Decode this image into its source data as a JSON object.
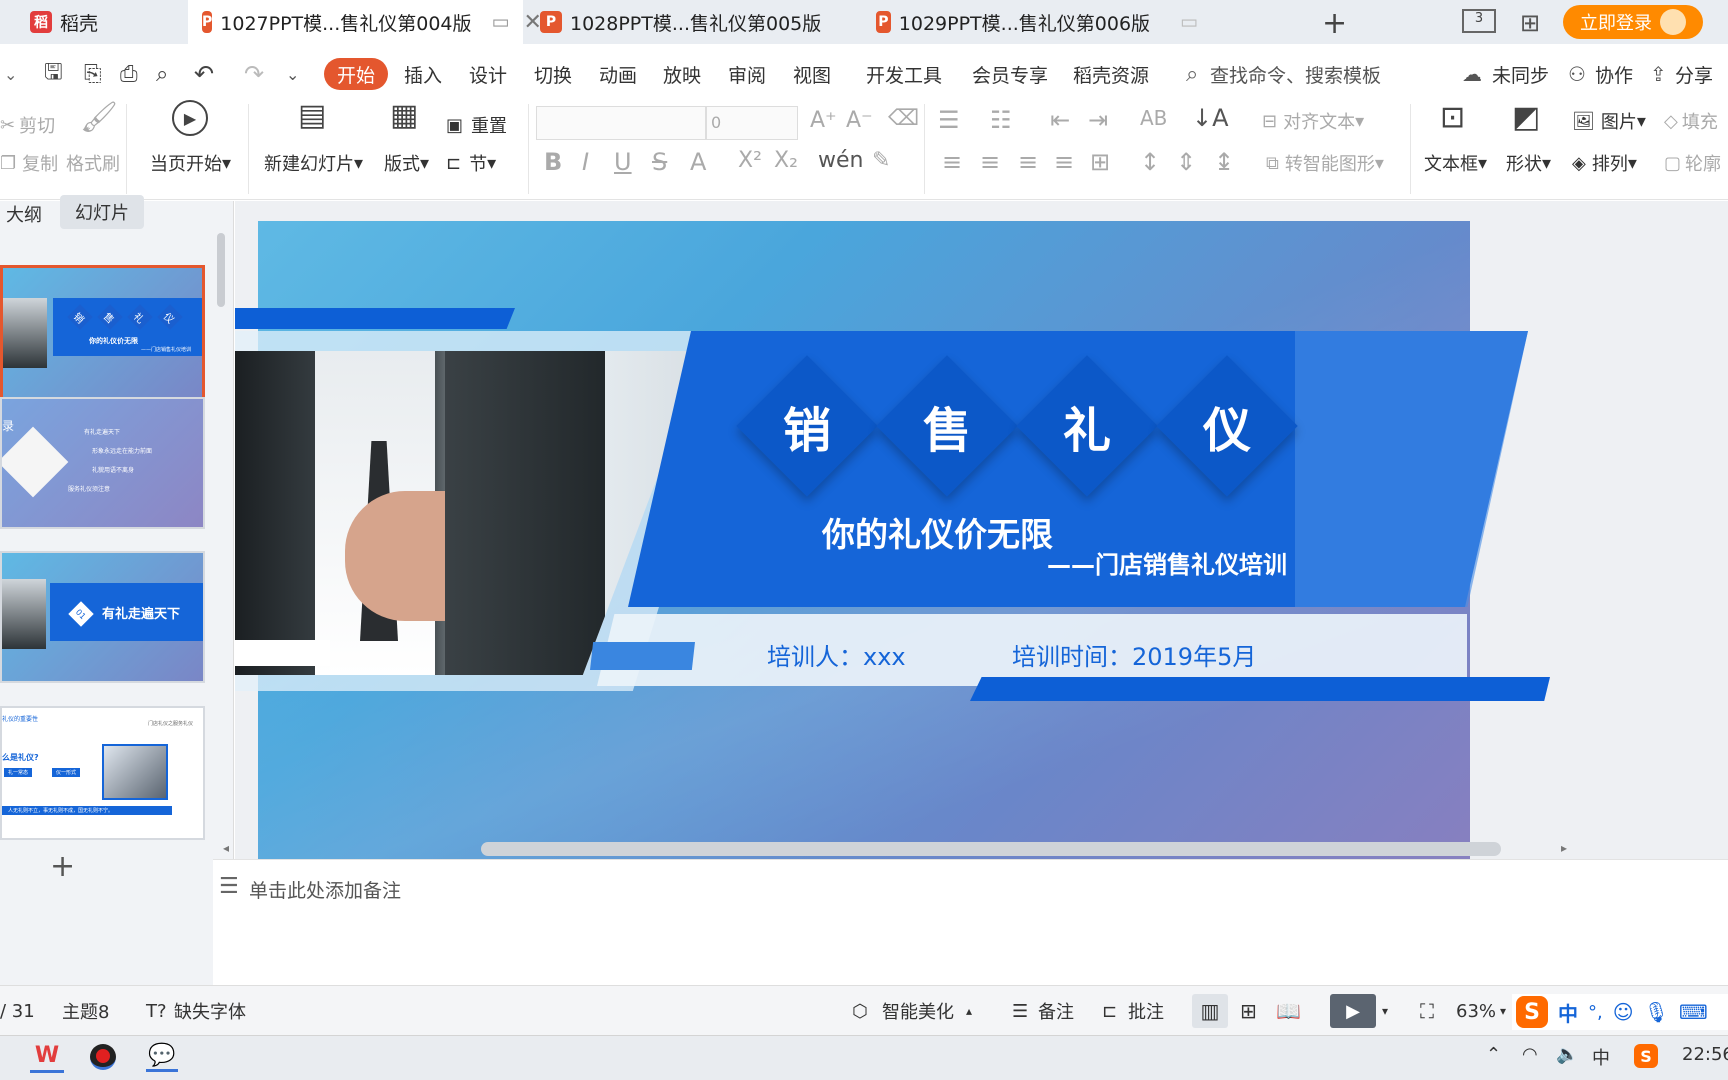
{
  "tabs": [
    {
      "label": "稻壳",
      "icon": "docer-icon"
    },
    {
      "label": "1027PPT模...售礼仪第004版",
      "icon": "ppt-icon"
    },
    {
      "label": "1028PPT模...售礼仪第005版",
      "icon": "ppt-icon"
    },
    {
      "label": "1029PPT模...售礼仪第006版",
      "icon": "ppt-icon"
    }
  ],
  "login_label": "立即登录",
  "menu": [
    "开始",
    "插入",
    "设计",
    "切换",
    "动画",
    "放映",
    "审阅",
    "视图",
    "开发工具",
    "会员专享",
    "稻壳资源"
  ],
  "search_placeholder": "查找命令、搜索模板",
  "right_menu": {
    "sync": "未同步",
    "collab": "协作",
    "share": "分享"
  },
  "ribbon": {
    "cut": "剪切",
    "copy": "复制",
    "format_painter": "格式刷",
    "start_from_current": "当页开始",
    "new_slide": "新建幻灯片",
    "layout": "版式",
    "reset": "重置",
    "section": "节",
    "font_size": "0",
    "align_text": "对齐文本",
    "smart_shape": "转智能图形",
    "textbox": "文本框",
    "shape": "形状",
    "picture": "图片",
    "arrange": "排列",
    "fill": "填充",
    "outline": "轮廓"
  },
  "left_tabs": {
    "outline": "大纲",
    "slides": "幻灯片"
  },
  "thumbs": [
    {
      "title_chars": [
        "销",
        "售",
        "礼",
        "仪"
      ],
      "subtitle": "你的礼仪价无限",
      "sub2": "——门店销售礼仪培训"
    },
    {
      "heading": "录",
      "items": [
        "有礼走遍天下",
        "形象永远走在能力前面",
        "礼貌用语不离身",
        "服务礼仪须注意"
      ]
    },
    {
      "num": "01",
      "title": "有礼走遍天下"
    },
    {
      "tag_left": "礼仪的重要性",
      "tag_right": "门店礼仪之服务礼仪",
      "question": "么是礼仪?",
      "chip1": "礼一常态",
      "chip2": "仪一形式",
      "footer": "人无礼则不立，事无礼则不成，国无礼则不宁。"
    }
  ],
  "slide": {
    "title_chars": [
      "销",
      "售",
      "礼",
      "仪"
    ],
    "subtitle": "你的礼仪价无限",
    "sub2": "——门店销售礼仪培训",
    "trainer": "培训人：xxx",
    "time": "培训时间：2019年5月"
  },
  "notes_placeholder": "单击此处添加备注",
  "status": {
    "page": "/ 31",
    "theme": "主题8",
    "missing_font": "缺失字体",
    "beautify": "智能美化",
    "notes": "备注",
    "comment": "批注",
    "zoom": "63%"
  },
  "ime": {
    "lang": "中",
    "punct": "°,"
  },
  "taskbar": {
    "ime": "中",
    "time": "22:56"
  },
  "colors": {
    "accent": "#e4572e",
    "wps_orange": "#ff8a00",
    "slide_blue": "#1565d8"
  }
}
